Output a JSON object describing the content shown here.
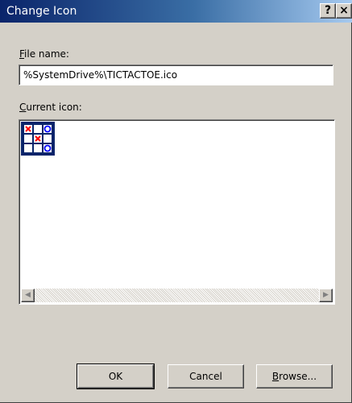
{
  "window": {
    "title": "Change Icon",
    "help_button": "?",
    "close_button": "×"
  },
  "file_name": {
    "label_accel": "F",
    "label_rest": "ile name:",
    "value": "%SystemDrive%\\TICTACTOE.ico"
  },
  "current_icon": {
    "label_accel": "C",
    "label_rest": "urrent icon:",
    "icons": [
      {
        "name": "tictactoe-icon",
        "selected": true,
        "board": [
          "X",
          "",
          "O",
          "",
          "X",
          "",
          "",
          "",
          "O"
        ]
      }
    ]
  },
  "scrollbar": {
    "left_arrow": "◀",
    "right_arrow": "▶"
  },
  "buttons": {
    "ok": "OK",
    "cancel": "Cancel",
    "browse_accel": "B",
    "browse_rest": "rowse..."
  },
  "colors": {
    "title_gradient_start": "#0a246a",
    "title_gradient_end": "#a6caf0",
    "dialog_face": "#d4d0c8",
    "selection": "#0a246a",
    "x_mark": "#ff0000",
    "o_mark": "#0000ff"
  }
}
